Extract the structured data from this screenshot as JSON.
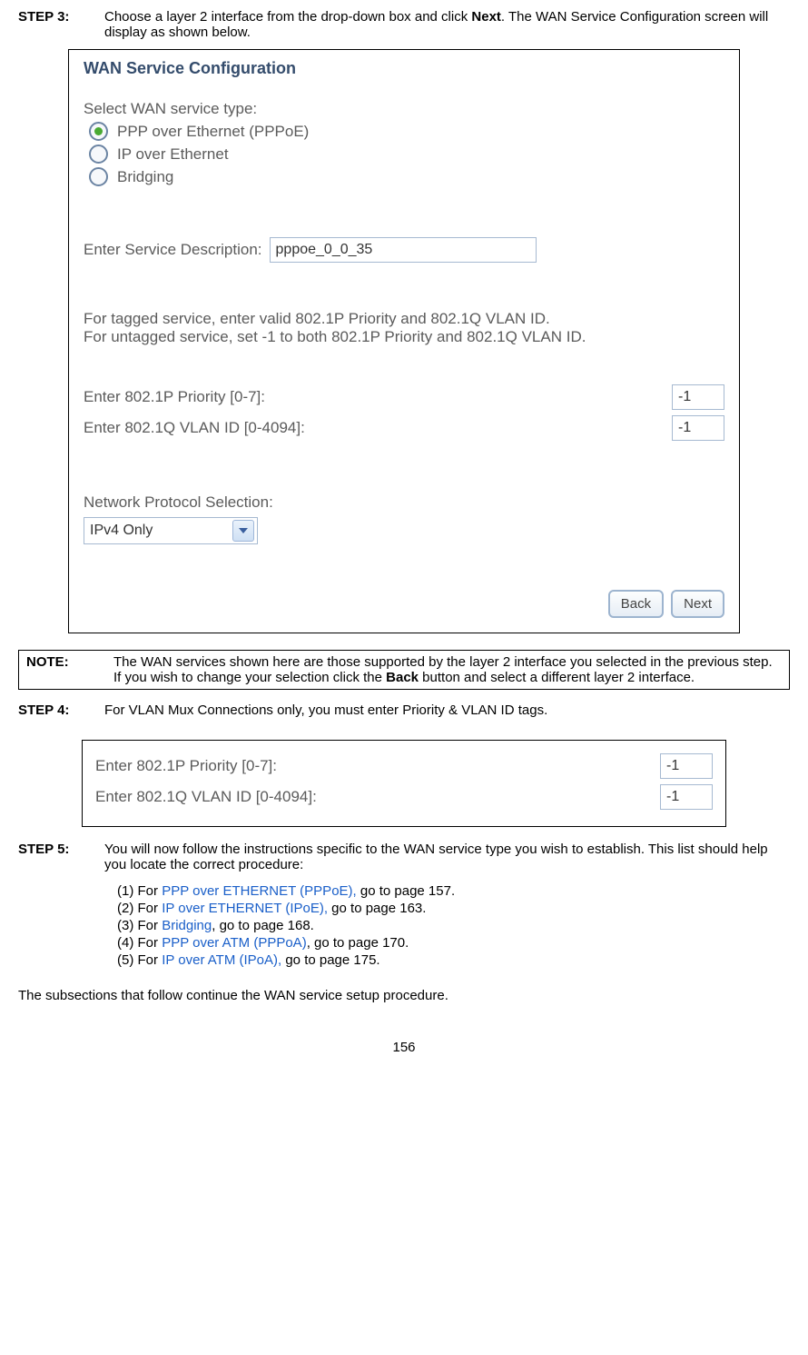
{
  "step3": {
    "label": "STEP 3:",
    "text_a": "Choose a layer 2 interface from the drop-down box and click ",
    "text_bold": "Next",
    "text_b": ". The WAN Service Configuration screen will display as shown below."
  },
  "wan": {
    "title": "WAN Service Configuration",
    "select_label": "Select WAN service type:",
    "opt_pppoe": "PPP over Ethernet (PPPoE)",
    "opt_ipoe": "IP over Ethernet",
    "opt_bridge": "Bridging",
    "desc_label": "Enter Service Description:",
    "desc_value": "pppoe_0_0_35",
    "tag_line1": "For tagged service, enter valid 802.1P Priority and 802.1Q VLAN ID.",
    "tag_line2": "For untagged service, set -1 to both 802.1P Priority and 802.1Q VLAN ID.",
    "prio_label": "Enter 802.1P Priority [0-7]:",
    "prio_value": "-1",
    "vlan_label": "Enter 802.1Q VLAN ID [0-4094]:",
    "vlan_value": "-1",
    "proto_label": "Network Protocol Selection:",
    "proto_value": "IPv4 Only",
    "back": "Back",
    "next": "Next"
  },
  "note": {
    "label": "NOTE:",
    "text_a": "The WAN services shown here are those supported by the layer 2 interface you selected in the previous step. If you wish to change your selection click the ",
    "text_bold": "Back",
    "text_b": " button and select a different layer 2 interface."
  },
  "step4": {
    "label": "STEP 4:",
    "text": "For VLAN Mux Connections only, you must enter Priority & VLAN ID tags."
  },
  "vlanbox": {
    "prio_label": "Enter 802.1P Priority [0-7]:",
    "prio_value": "-1",
    "vlan_label": "Enter 802.1Q VLAN ID [0-4094]:",
    "vlan_value": "-1"
  },
  "step5": {
    "label": "STEP 5:",
    "text": "You will now follow the instructions specific to the WAN service type you wish to establish. This list should help you locate the correct procedure:",
    "items": [
      {
        "n": "(1)",
        "pre": "For ",
        "link": "PPP over ETHERNET (PPPoE),",
        "post": " go to page 157."
      },
      {
        "n": "(2)",
        "pre": "For ",
        "link": "IP over ETHERNET (IPoE),",
        "post": " go to page 163."
      },
      {
        "n": "(3)",
        "pre": "For ",
        "link": "Bridging",
        "post": ", go to page 168."
      },
      {
        "n": "(4)",
        "pre": "For ",
        "link": "PPP over ATM (PPPoA)",
        "post": ", go to page 170."
      },
      {
        "n": "(5)",
        "pre": "For ",
        "link": "IP over ATM (IPoA),",
        "post": " go to page 175."
      }
    ]
  },
  "closing": "The subsections that follow continue the WAN service setup procedure.",
  "page": "156"
}
